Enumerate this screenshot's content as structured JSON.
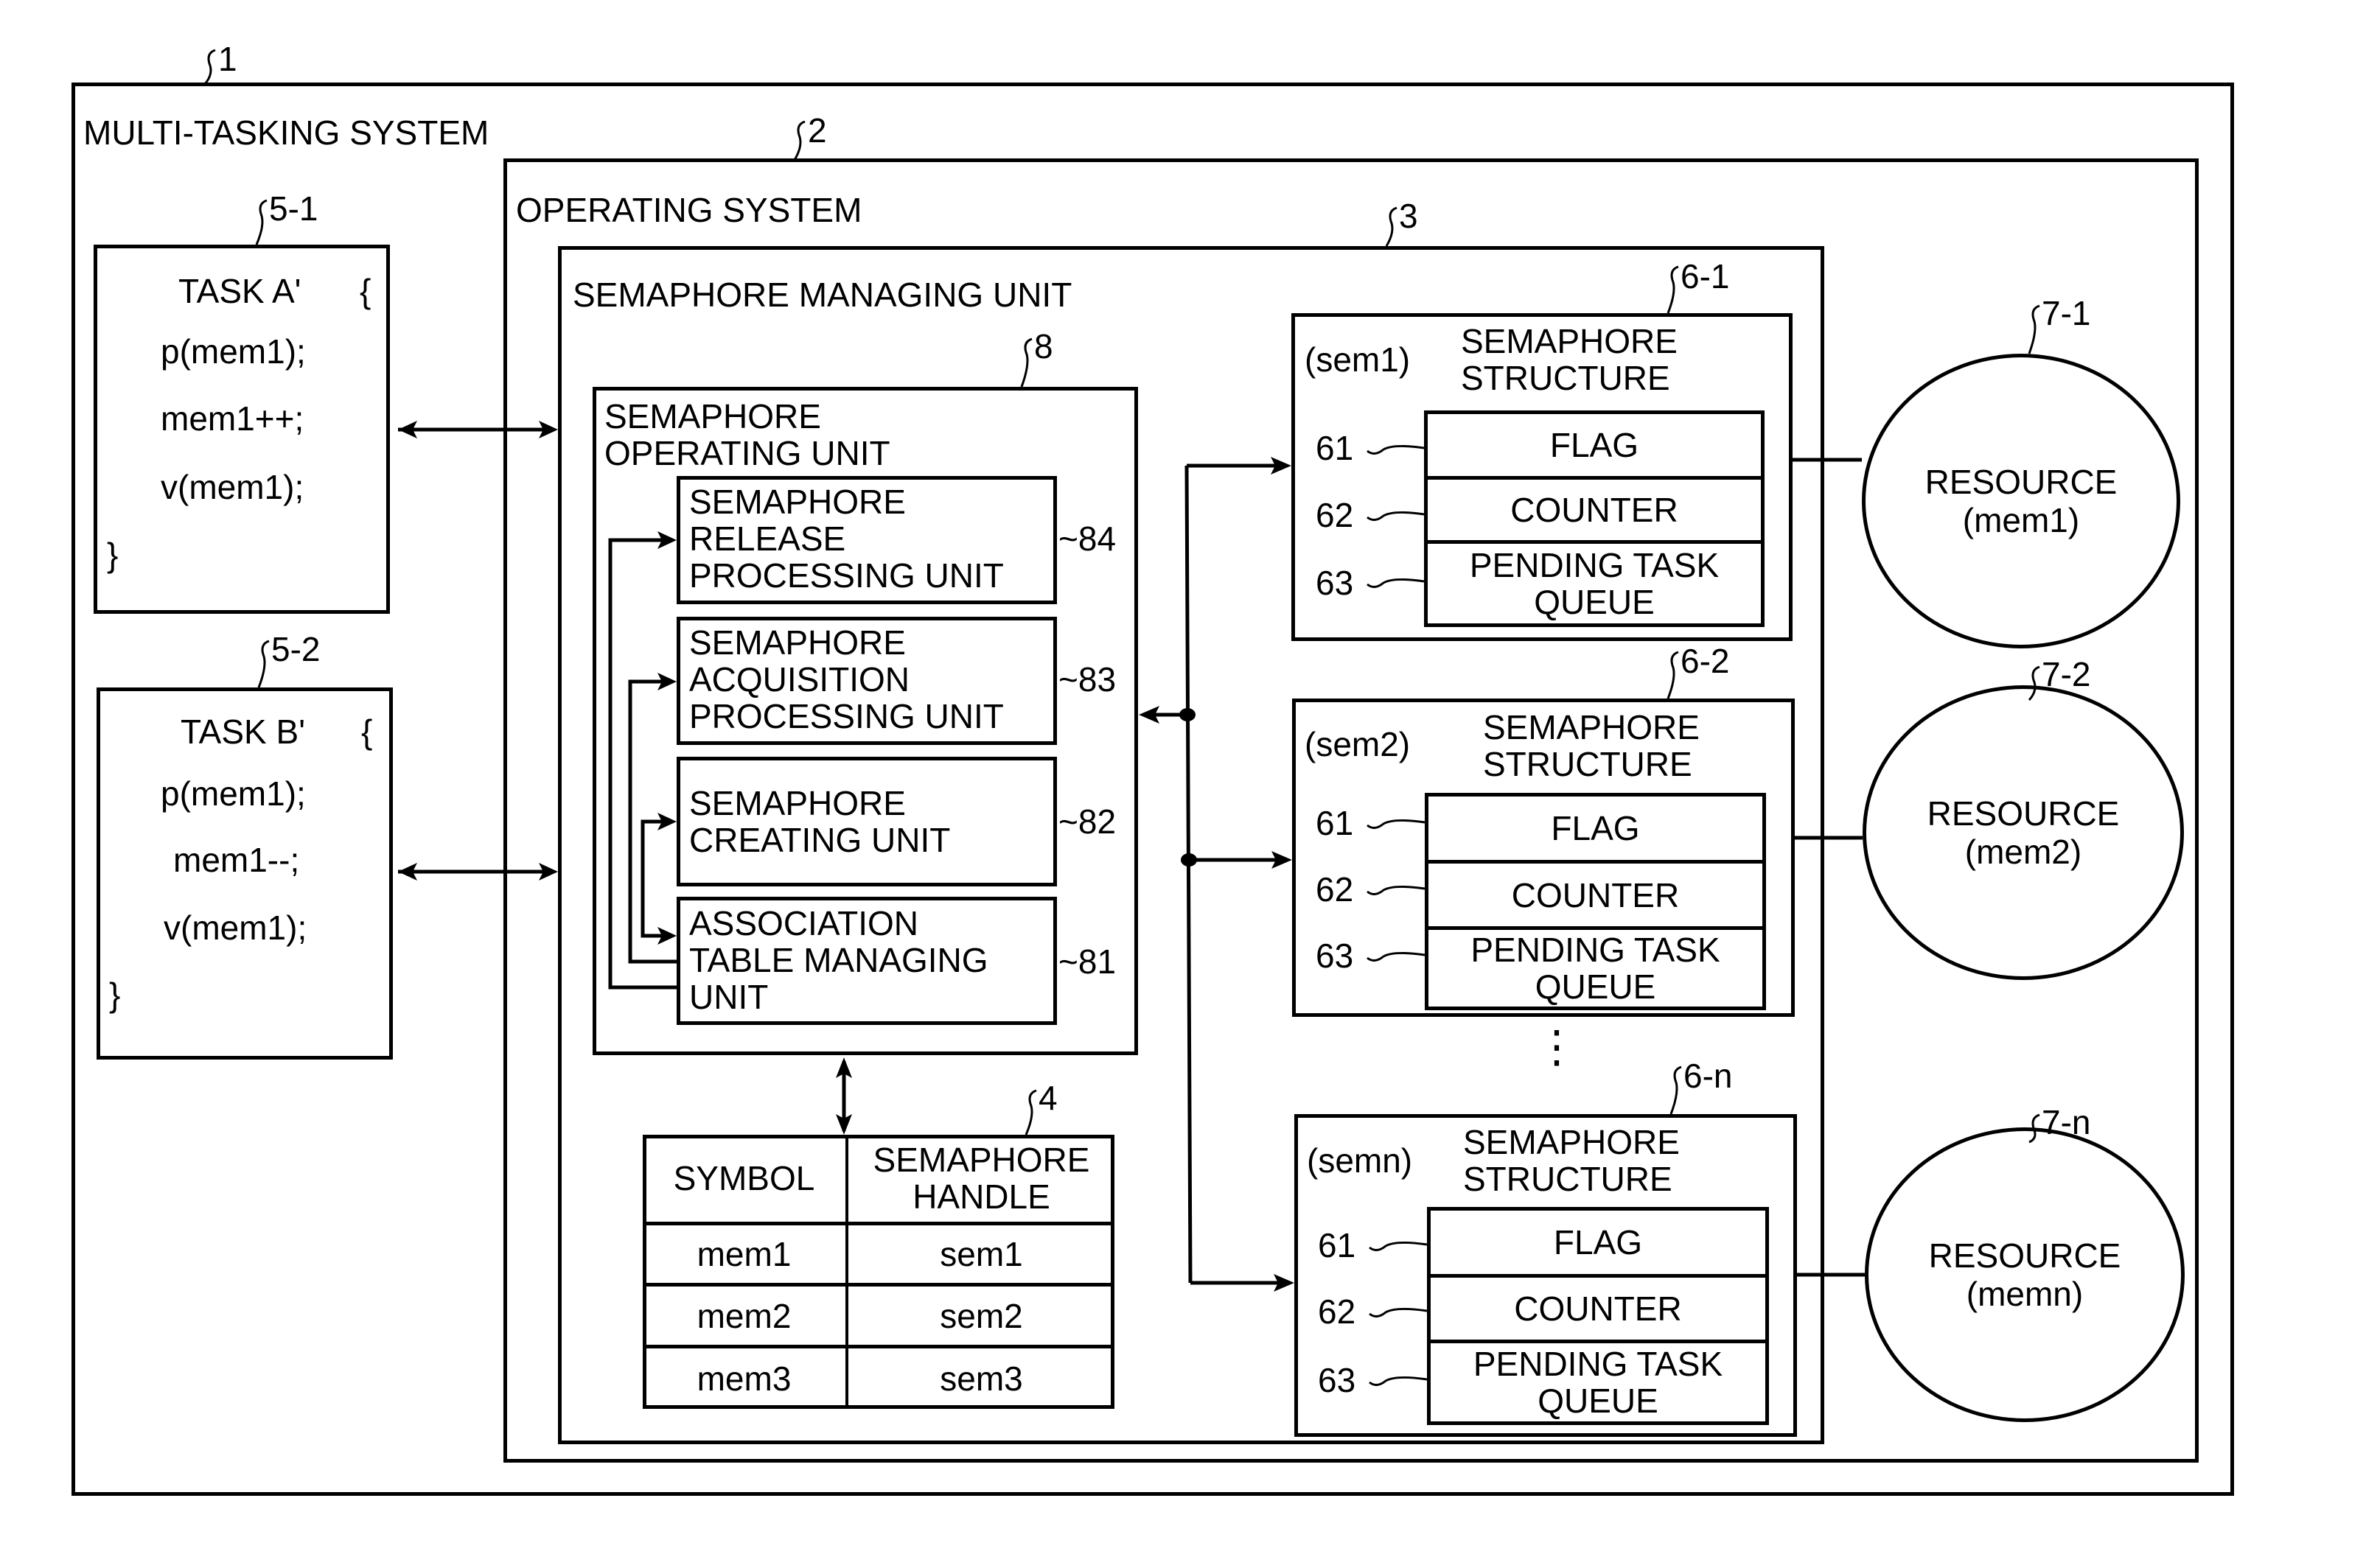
{
  "figure": {
    "system": {
      "ref": "1",
      "title": "MULTI-TASKING SYSTEM"
    },
    "os": {
      "ref": "2",
      "title": "OPERATING SYSTEM"
    },
    "semaphore_managing_unit": {
      "ref": "3",
      "title": "SEMAPHORE MANAGING UNIT"
    },
    "tasks": [
      {
        "ref": "5-1",
        "name": "TASK A'",
        "open_brace": "{",
        "lines": [
          "p(mem1);",
          "mem1++;",
          "v(mem1);"
        ],
        "close_brace": "}"
      },
      {
        "ref": "5-2",
        "name": "TASK B'",
        "open_brace": "{",
        "lines": [
          "p(mem1);",
          "mem1--;",
          "v(mem1);"
        ],
        "close_brace": "}"
      }
    ],
    "operating_unit": {
      "ref": "8",
      "title_line1": "SEMAPHORE",
      "title_line2": "OPERATING UNIT",
      "subunits": [
        {
          "ref": "84",
          "lines": [
            "SEMAPHORE",
            "RELEASE",
            "PROCESSING UNIT"
          ]
        },
        {
          "ref": "83",
          "lines": [
            "SEMAPHORE",
            "ACQUISITION",
            "PROCESSING UNIT"
          ]
        },
        {
          "ref": "82",
          "lines": [
            "SEMAPHORE",
            "CREATING UNIT"
          ]
        },
        {
          "ref": "81",
          "lines": [
            "ASSOCIATION",
            "TABLE MANAGING",
            "UNIT"
          ]
        }
      ]
    },
    "association_table": {
      "ref": "4",
      "headers": [
        "SYMBOL",
        "SEMAPHORE HANDLE"
      ],
      "header2_line1": "SEMAPHORE",
      "header2_line2": "HANDLE",
      "rows": [
        [
          "mem1",
          "sem1"
        ],
        [
          "mem2",
          "sem2"
        ],
        [
          "mem3",
          "sem3"
        ]
      ]
    },
    "semaphore_structures": [
      {
        "ref": "6-1",
        "handle": "(sem1)",
        "title_line1": "SEMAPHORE",
        "title_line2": "STRUCTURE",
        "fields": [
          {
            "ref": "61",
            "label": "FLAG"
          },
          {
            "ref": "62",
            "label": "COUNTER"
          },
          {
            "ref": "63",
            "label1": "PENDING TASK",
            "label2": "QUEUE"
          }
        ]
      },
      {
        "ref": "6-2",
        "handle": "(sem2)",
        "title_line1": "SEMAPHORE",
        "title_line2": "STRUCTURE",
        "fields": [
          {
            "ref": "61",
            "label": "FLAG"
          },
          {
            "ref": "62",
            "label": "COUNTER"
          },
          {
            "ref": "63",
            "label1": "PENDING TASK",
            "label2": "QUEUE"
          }
        ]
      },
      {
        "ref": "6-n",
        "handle": "(semn)",
        "title_line1": "SEMAPHORE",
        "title_line2": "STRUCTURE",
        "fields": [
          {
            "ref": "61",
            "label": "FLAG"
          },
          {
            "ref": "62",
            "label": "COUNTER"
          },
          {
            "ref": "63",
            "label1": "PENDING TASK",
            "label2": "QUEUE"
          }
        ]
      }
    ],
    "ellipsis": "⋮",
    "resources": [
      {
        "ref": "7-1",
        "label": "RESOURCE",
        "name": "(mem1)"
      },
      {
        "ref": "7-2",
        "label": "RESOURCE",
        "name": "(mem2)"
      },
      {
        "ref": "7-n",
        "label": "RESOURCE",
        "name": "(memn)"
      }
    ]
  }
}
